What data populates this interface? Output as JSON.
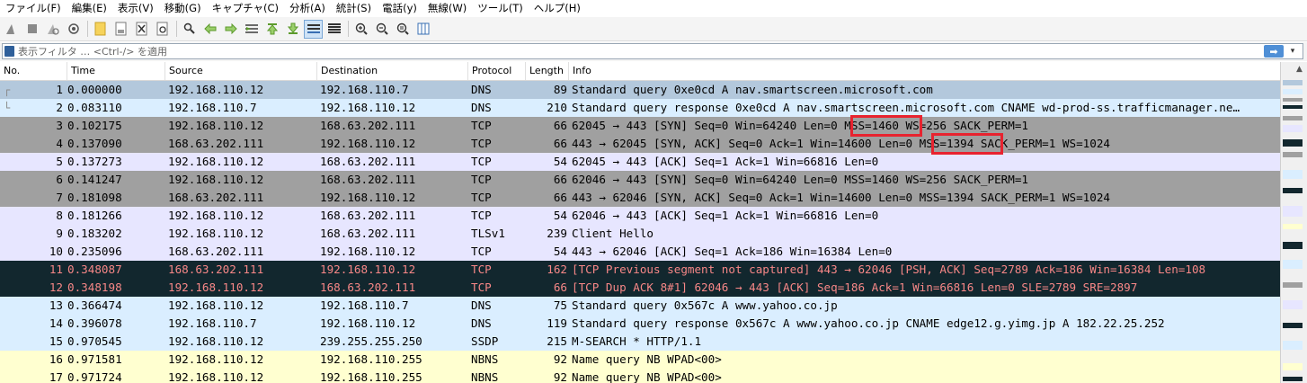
{
  "menu": [
    "ファイル(F)",
    "編集(E)",
    "表示(V)",
    "移動(G)",
    "キャプチャ(C)",
    "分析(A)",
    "統計(S)",
    "電話(y)",
    "無線(W)",
    "ツール(T)",
    "ヘルプ(H)"
  ],
  "toolbar": {
    "icons": [
      "shark-fin-start-icon",
      "stop-icon",
      "restart-icon",
      "capture-options-icon",
      "open-file-icon",
      "save-file-icon",
      "close-file-icon",
      "reload-icon",
      "find-packet-icon",
      "go-back-icon",
      "go-forward-icon",
      "go-to-packet-icon",
      "go-first-icon",
      "go-last-icon",
      "autoscroll-icon",
      "colorize-icon",
      "zoom-in-icon",
      "zoom-out-icon",
      "zoom-normal-icon",
      "resize-columns-icon"
    ]
  },
  "filter": {
    "placeholder": "表示フィルタ … <Ctrl-/> を適用"
  },
  "columns": {
    "no": "No.",
    "time": "Time",
    "source": "Source",
    "destination": "Destination",
    "protocol": "Protocol",
    "length": "Length",
    "info": "Info"
  },
  "colors": {
    "dns": "#b3c8dc",
    "dns_alt": "#dae8f5",
    "tcp_syn": "#a0a0a0",
    "tcp": "#e7e6ff",
    "udp": "#daeeff",
    "nbns": "#ffffd0",
    "bad_tcp_bg": "#12272e",
    "bad_tcp_fg": "#f78787",
    "highlight": "#e8232f"
  },
  "packets": [
    {
      "no": "1",
      "time": "0.000000",
      "src": "192.168.110.12",
      "dst": "192.168.110.7",
      "proto": "DNS",
      "len": "89",
      "info": "Standard query 0xe0cd A nav.smartscreen.microsoft.com",
      "bg": "#b3c8dc",
      "fg": "#000000"
    },
    {
      "no": "2",
      "time": "0.083110",
      "src": "192.168.110.7",
      "dst": "192.168.110.12",
      "proto": "DNS",
      "len": "210",
      "info": "Standard query response 0xe0cd A nav.smartscreen.microsoft.com CNAME wd-prod-ss.trafficmanager.ne…",
      "bg": "#daeeff",
      "fg": "#000000"
    },
    {
      "no": "3",
      "time": "0.102175",
      "src": "192.168.110.12",
      "dst": "168.63.202.111",
      "proto": "TCP",
      "len": "66",
      "info": "62045 → 443 [SYN] Seq=0 Win=64240 Len=0 MSS=1460 WS=256 SACK_PERM=1",
      "bg": "#a0a0a0",
      "fg": "#000000"
    },
    {
      "no": "4",
      "time": "0.137090",
      "src": "168.63.202.111",
      "dst": "192.168.110.12",
      "proto": "TCP",
      "len": "66",
      "info": "443 → 62045 [SYN, ACK] Seq=0 Ack=1 Win=14600 Len=0 MSS=1394 SACK_PERM=1 WS=1024",
      "bg": "#a0a0a0",
      "fg": "#000000"
    },
    {
      "no": "5",
      "time": "0.137273",
      "src": "192.168.110.12",
      "dst": "168.63.202.111",
      "proto": "TCP",
      "len": "54",
      "info": "62045 → 443 [ACK] Seq=1 Ack=1 Win=66816 Len=0",
      "bg": "#e7e6ff",
      "fg": "#000000"
    },
    {
      "no": "6",
      "time": "0.141247",
      "src": "192.168.110.12",
      "dst": "168.63.202.111",
      "proto": "TCP",
      "len": "66",
      "info": "62046 → 443 [SYN] Seq=0 Win=64240 Len=0 MSS=1460 WS=256 SACK_PERM=1",
      "bg": "#a0a0a0",
      "fg": "#000000"
    },
    {
      "no": "7",
      "time": "0.181098",
      "src": "168.63.202.111",
      "dst": "192.168.110.12",
      "proto": "TCP",
      "len": "66",
      "info": "443 → 62046 [SYN, ACK] Seq=0 Ack=1 Win=14600 Len=0 MSS=1394 SACK_PERM=1 WS=1024",
      "bg": "#a0a0a0",
      "fg": "#000000"
    },
    {
      "no": "8",
      "time": "0.181266",
      "src": "192.168.110.12",
      "dst": "168.63.202.111",
      "proto": "TCP",
      "len": "54",
      "info": "62046 → 443 [ACK] Seq=1 Ack=1 Win=66816 Len=0",
      "bg": "#e7e6ff",
      "fg": "#000000"
    },
    {
      "no": "9",
      "time": "0.183202",
      "src": "192.168.110.12",
      "dst": "168.63.202.111",
      "proto": "TLSv1",
      "len": "239",
      "info": "Client Hello",
      "bg": "#e7e6ff",
      "fg": "#000000"
    },
    {
      "no": "10",
      "time": "0.235096",
      "src": "168.63.202.111",
      "dst": "192.168.110.12",
      "proto": "TCP",
      "len": "54",
      "info": "443 → 62046 [ACK] Seq=1 Ack=186 Win=16384 Len=0",
      "bg": "#e7e6ff",
      "fg": "#000000"
    },
    {
      "no": "11",
      "time": "0.348087",
      "src": "168.63.202.111",
      "dst": "192.168.110.12",
      "proto": "TCP",
      "len": "162",
      "info": "[TCP Previous segment not captured] 443 → 62046 [PSH, ACK] Seq=2789 Ack=186 Win=16384 Len=108",
      "bg": "#12272e",
      "fg": "#f78787"
    },
    {
      "no": "12",
      "time": "0.348198",
      "src": "192.168.110.12",
      "dst": "168.63.202.111",
      "proto": "TCP",
      "len": "66",
      "info": "[TCP Dup ACK 8#1] 62046 → 443 [ACK] Seq=186 Ack=1 Win=66816 Len=0 SLE=2789 SRE=2897",
      "bg": "#12272e",
      "fg": "#f78787"
    },
    {
      "no": "13",
      "time": "0.366474",
      "src": "192.168.110.12",
      "dst": "192.168.110.7",
      "proto": "DNS",
      "len": "75",
      "info": "Standard query 0x567c A www.yahoo.co.jp",
      "bg": "#daeeff",
      "fg": "#000000"
    },
    {
      "no": "14",
      "time": "0.396078",
      "src": "192.168.110.7",
      "dst": "192.168.110.12",
      "proto": "DNS",
      "len": "119",
      "info": "Standard query response 0x567c A www.yahoo.co.jp CNAME edge12.g.yimg.jp A 182.22.25.252",
      "bg": "#daeeff",
      "fg": "#000000"
    },
    {
      "no": "15",
      "time": "0.970545",
      "src": "192.168.110.12",
      "dst": "239.255.255.250",
      "proto": "SSDP",
      "len": "215",
      "info": "M-SEARCH * HTTP/1.1",
      "bg": "#daeeff",
      "fg": "#000000"
    },
    {
      "no": "16",
      "time": "0.971581",
      "src": "192.168.110.12",
      "dst": "192.168.110.255",
      "proto": "NBNS",
      "len": "92",
      "info": "Name query NB WPAD<00>",
      "bg": "#ffffd0",
      "fg": "#000000"
    },
    {
      "no": "17",
      "time": "0.971724",
      "src": "192.168.110.12",
      "dst": "192.168.110.255",
      "proto": "NBNS",
      "len": "92",
      "info": "Name query NB WPAD<00>",
      "bg": "#ffffd0",
      "fg": "#000000"
    }
  ]
}
